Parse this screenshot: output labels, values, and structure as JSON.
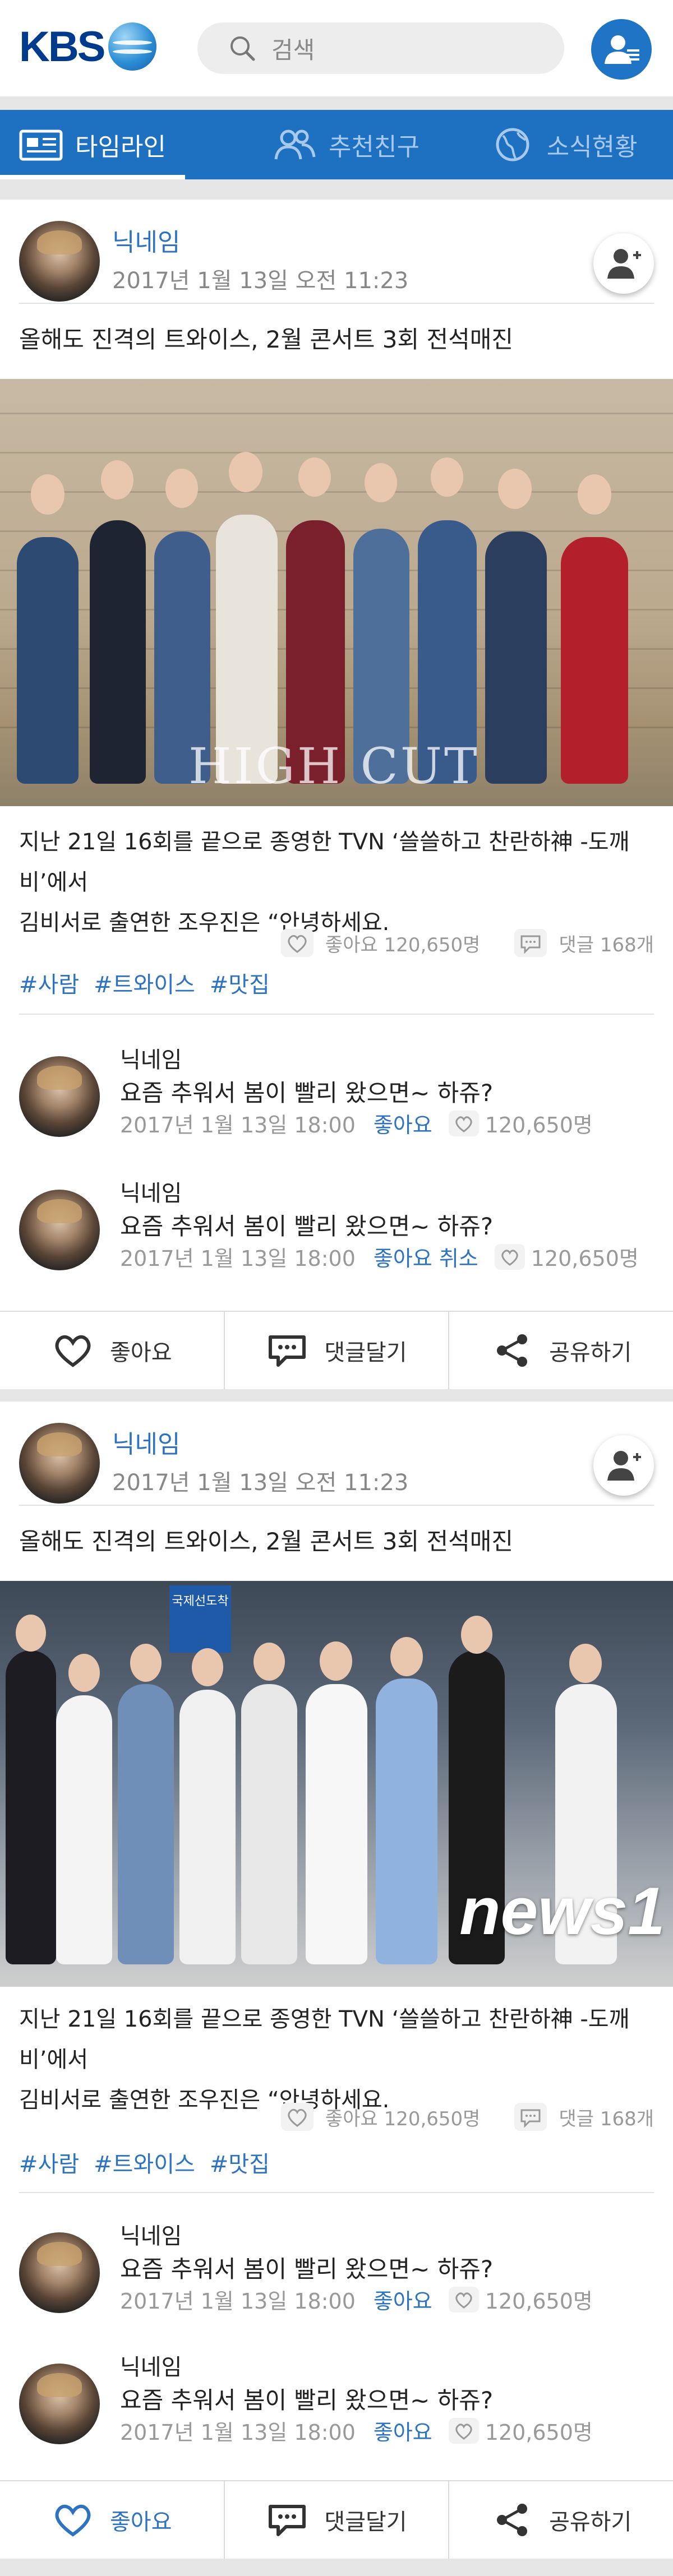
{
  "header": {
    "logo_text": "KBS",
    "search_placeholder": "검색",
    "icons": {
      "search": "search-icon",
      "profile": "user-profile-icon"
    }
  },
  "tabs": [
    {
      "label": "타임라인",
      "icon": "timeline-icon",
      "active": true
    },
    {
      "label": "추천친구",
      "icon": "friends-icon",
      "active": false
    },
    {
      "label": "소식현황",
      "icon": "globe-icon",
      "active": false
    }
  ],
  "colors": {
    "brand": "#003a8c",
    "accent": "#1e70c1",
    "link": "#2e73c2"
  },
  "posts": [
    {
      "nickname": "닉네임",
      "date": "2017년 1월 13일 오전 11:23",
      "title": "올해도 진격의 트와이스, 2월 콘서트 3회 전석매진",
      "photo_watermark": "HIGH CUT",
      "description_line1": "지난 21일 16회를 끝으로 종영한 TVN ‘쓸쓸하고 찬란하神 -도깨비’에서",
      "description_line2": "김비서로 출연한 조우진은 “안녕하세요.",
      "likes": "좋아요 120,650명",
      "comments_count": "댓글 168개",
      "tags": [
        "#사람",
        "#트와이스",
        "#맛집"
      ],
      "comments": [
        {
          "nickname": "닉네임",
          "text": "요즘 추워서 봄이 빨리 왔으면~ 하쥬?",
          "date": "2017년 1월 13일 18:00",
          "like_label": "좋아요",
          "like_count": "120,650명"
        },
        {
          "nickname": "닉네임",
          "text": "요즘 추워서 봄이 빨리 왔으면~ 하쥬?",
          "date": "2017년 1월 13일 18:00",
          "like_label": "좋아요 취소",
          "like_count": "120,650명"
        }
      ],
      "actions": {
        "like": "좋아요",
        "comment": "댓글달기",
        "share": "공유하기"
      }
    },
    {
      "nickname": "닉네임",
      "date": "2017년 1월 13일 오전 11:23",
      "title": "올해도 진격의 트와이스, 2월 콘서트 3회 전석매진",
      "photo_watermark": "news1",
      "photo_sign": "국제선도착",
      "description_line1": "지난 21일 16회를 끝으로 종영한 TVN ‘쓸쓸하고 찬란하神 -도깨비’에서",
      "description_line2": "김비서로 출연한 조우진은 “안녕하세요.",
      "likes": "좋아요 120,650명",
      "comments_count": "댓글 168개",
      "tags": [
        "#사람",
        "#트와이스",
        "#맛집"
      ],
      "comments": [
        {
          "nickname": "닉네임",
          "text": "요즘 추워서 봄이 빨리 왔으면~ 하쥬?",
          "date": "2017년 1월 13일 18:00",
          "like_label": "좋아요",
          "like_count": "120,650명"
        },
        {
          "nickname": "닉네임",
          "text": "요즘 추워서 봄이 빨리 왔으면~ 하쥬?",
          "date": "2017년 1월 13일 18:00",
          "like_label": "좋아요",
          "like_count": "120,650명"
        }
      ],
      "actions": {
        "like": "좋아요",
        "comment": "댓글달기",
        "share": "공유하기"
      }
    }
  ]
}
